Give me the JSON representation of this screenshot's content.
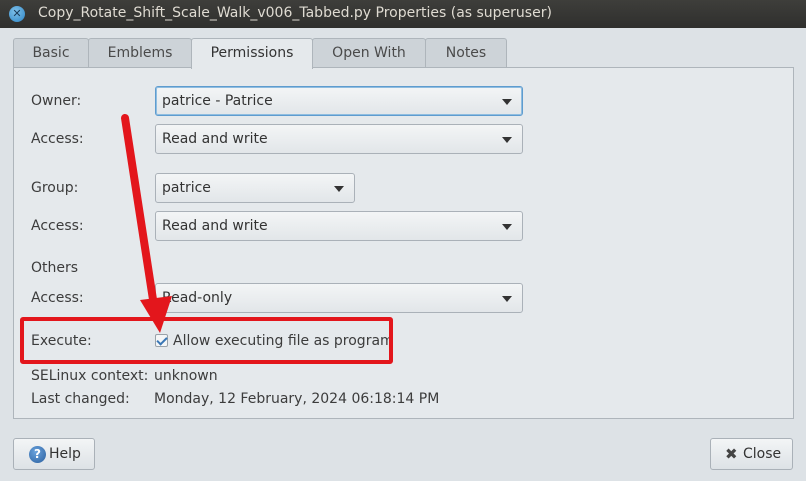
{
  "window": {
    "title": "Copy_Rotate_Shift_Scale_Walk_v006_Tabbed.py Properties (as superuser)"
  },
  "tabs": [
    {
      "label": "Basic",
      "active": false
    },
    {
      "label": "Emblems",
      "active": false
    },
    {
      "label": "Permissions",
      "active": true
    },
    {
      "label": "Open With",
      "active": false
    },
    {
      "label": "Notes",
      "active": false
    }
  ],
  "permissions": {
    "owner_label": "Owner:",
    "owner_value": "patrice - Patrice",
    "owner_access_label": "Access:",
    "owner_access_value": "Read and write",
    "group_label": "Group:",
    "group_value": "patrice",
    "group_access_label": "Access:",
    "group_access_value": "Read and write",
    "others_label": "Others",
    "others_access_label": "Access:",
    "others_access_value": "Read-only",
    "execute_label": "Execute:",
    "execute_checkbox_label": "Allow executing file as program",
    "execute_checked": true,
    "selinux_label": "SELinux context:",
    "selinux_value": "unknown",
    "last_changed_label": "Last changed:",
    "last_changed_value": "Monday, 12 February, 2024 06:18:14 PM"
  },
  "buttons": {
    "help_label": "Help",
    "close_label": "Close"
  },
  "icons": {
    "window_close": "close-icon",
    "help": "help-icon",
    "close": "close-x-icon"
  },
  "colors": {
    "annotation_red": "#e3161c",
    "titlebar": "#3a3a37",
    "focus_blue": "#5e9ccf"
  }
}
